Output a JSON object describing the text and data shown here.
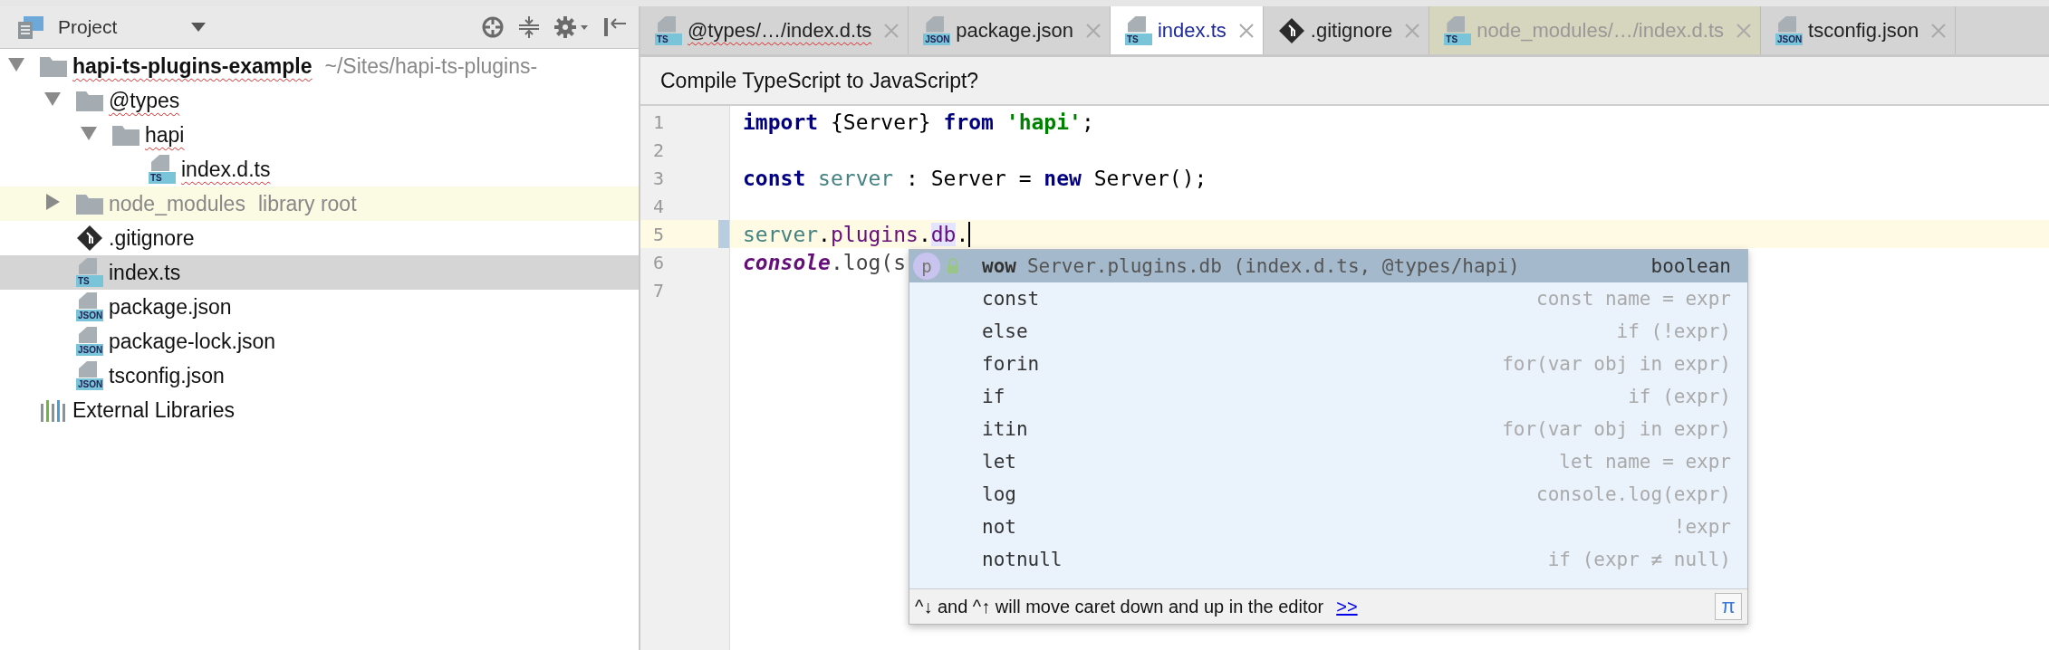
{
  "project_panel": {
    "title": "Project",
    "tree": [
      {
        "label": "hapi-ts-plugins-example",
        "suffix": "~/Sites/hapi-ts-plugins-",
        "kind": "folder",
        "bold": true,
        "spell_error": true,
        "expanded": true,
        "selected": false,
        "children": [
          {
            "label": "@types",
            "kind": "folder",
            "spell_error": true,
            "expanded": true,
            "selected": false,
            "children": [
              {
                "label": "hapi",
                "kind": "folder",
                "spell_error": true,
                "expanded": true,
                "selected": false,
                "children": [
                  {
                    "label": "index.d.ts",
                    "kind": "file",
                    "badge": "TS",
                    "spell_error": true,
                    "selected": false
                  }
                ]
              }
            ]
          },
          {
            "label": "node_modules",
            "suffix": "library root",
            "kind": "folder",
            "library": true,
            "expanded": false,
            "selected": false
          },
          {
            "label": ".gitignore",
            "kind": "git",
            "selected": false
          },
          {
            "label": "index.ts",
            "kind": "file",
            "badge": "TS",
            "selected": true
          },
          {
            "label": "package.json",
            "kind": "file",
            "badge": "JSON",
            "selected": false
          },
          {
            "label": "package-lock.json",
            "kind": "file",
            "badge": "JSON",
            "selected": false
          },
          {
            "label": "tsconfig.json",
            "kind": "file",
            "badge": "JSON",
            "selected": false
          }
        ]
      },
      {
        "label": "External Libraries",
        "kind": "libraries",
        "selected": false
      }
    ]
  },
  "tabs": [
    {
      "label": "@types/…/index.d.ts",
      "kind": "file",
      "badge": "TS",
      "spell_error": true,
      "library": false,
      "selected": false
    },
    {
      "label": "package.json",
      "kind": "file",
      "badge": "JSON",
      "library": false,
      "selected": false
    },
    {
      "label": "index.ts",
      "kind": "file",
      "badge": "TS",
      "library": false,
      "selected": true
    },
    {
      "label": ".gitignore",
      "kind": "git",
      "library": false,
      "selected": false
    },
    {
      "label": "node_modules/…/index.d.ts",
      "kind": "file",
      "badge": "TS",
      "library": true,
      "selected": false
    },
    {
      "label": "tsconfig.json",
      "kind": "file",
      "badge": "JSON",
      "library": false,
      "selected": false
    }
  ],
  "banner": "Compile TypeScript to JavaScript?",
  "code": [
    {
      "number": "1",
      "current": false,
      "tokens": [
        {
          "text": "import",
          "kind": "keyword"
        },
        {
          "text": " {Server} ",
          "kind": "plain"
        },
        {
          "text": "from",
          "kind": "keyword"
        },
        {
          "text": " 'hapi'",
          "kind": "string"
        },
        {
          "text": ";",
          "kind": "plain"
        }
      ]
    },
    {
      "number": "2",
      "current": false
    },
    {
      "number": "3",
      "current": false,
      "tokens": [
        {
          "text": "const",
          "kind": "keyword"
        },
        {
          "text": " server",
          "kind": "variable"
        },
        {
          "text": " : Server = ",
          "kind": "plain"
        },
        {
          "text": "new",
          "kind": "keyword"
        },
        {
          "text": " Server();",
          "kind": "plain"
        }
      ]
    },
    {
      "number": "4",
      "current": false
    },
    {
      "number": "5",
      "current": true,
      "tokens": [
        {
          "text": "server",
          "kind": "variable"
        },
        {
          "text": ".",
          "kind": "plain"
        },
        {
          "text": "plugins",
          "kind": "field"
        },
        {
          "text": ".",
          "kind": "plain"
        },
        {
          "text": "db",
          "kind": "field_usage"
        },
        {
          "text": ".",
          "kind": "plain"
        }
      ]
    },
    {
      "number": "6",
      "current": false,
      "tokens": [
        {
          "text": "console",
          "kind": "global"
        },
        {
          "text": ".log(s",
          "kind": "method"
        }
      ]
    },
    {
      "number": "7",
      "current": false
    }
  ],
  "completion": {
    "items": [
      {
        "kind": "property",
        "badge": "p",
        "name": "wow",
        "location": "Server.plugins.db (index.d.ts, @types/hapi)",
        "detail": "boolean",
        "selected": true
      },
      {
        "kind": "template",
        "name": "const",
        "detail": "const name = expr",
        "selected": false
      },
      {
        "kind": "template",
        "name": "else",
        "detail": "if (!expr)",
        "selected": false
      },
      {
        "kind": "template",
        "name": "forin",
        "detail": "for(var obj in expr)",
        "selected": false
      },
      {
        "kind": "template",
        "name": "if",
        "detail": "if (expr)",
        "selected": false
      },
      {
        "kind": "template",
        "name": "itin",
        "detail": "for(var obj in expr)",
        "selected": false
      },
      {
        "kind": "template",
        "name": "let",
        "detail": "let name = expr",
        "selected": false
      },
      {
        "kind": "template",
        "name": "log",
        "detail": "console.log(expr)",
        "selected": false
      },
      {
        "kind": "template",
        "name": "not",
        "detail": "!expr",
        "selected": false
      },
      {
        "kind": "template",
        "name": "notnull",
        "detail": "if (expr ≠ null)",
        "selected": false
      }
    ],
    "hint": "^↓ and ^↑ will move caret down and up in the editor",
    "hint_link": ">>",
    "pi_button": "π"
  }
}
